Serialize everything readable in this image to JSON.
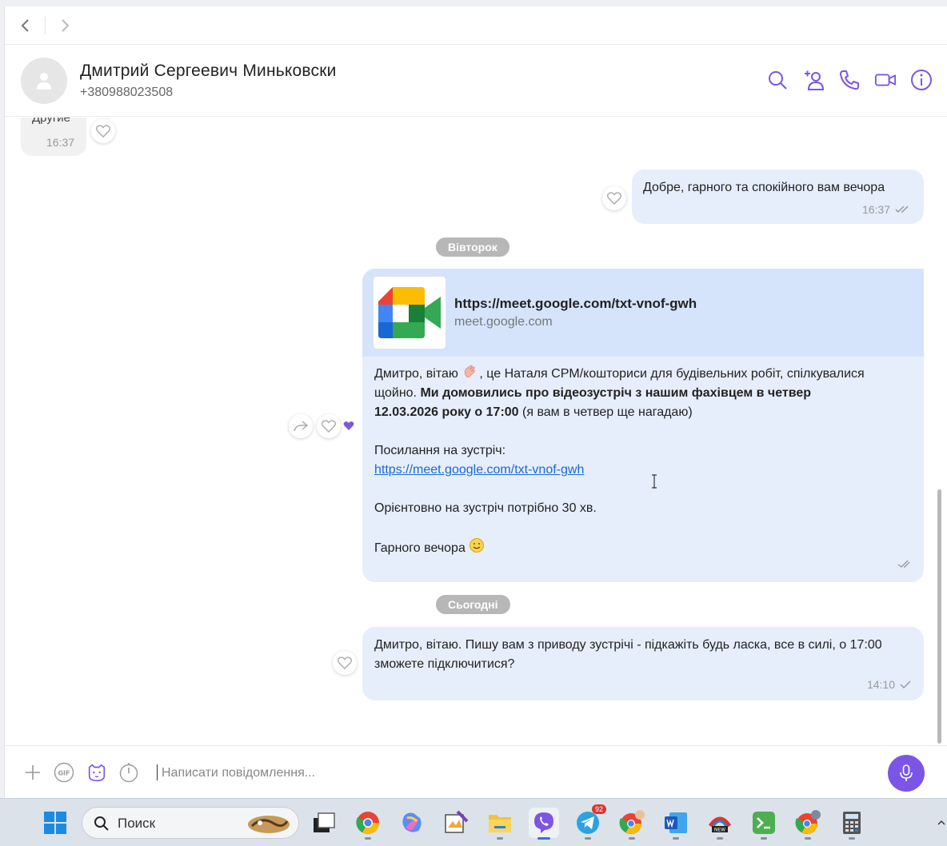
{
  "contact": {
    "name": "Дмитрий Сергеевич Миньковски",
    "phone": "+380988023508"
  },
  "messages": {
    "incoming_preview": {
      "text": "Другие",
      "time": "16:37"
    },
    "out1": {
      "text": "Добре, гарного та спокійного вам вечора",
      "time": "16:37"
    },
    "date1": "Вівторок",
    "out2": {
      "link_title": "https://meet.google.com/txt-vnof-gwh",
      "link_domain": "meet.google.com",
      "p1_a": "Дмитро, вітаю ",
      "p1_b": ", це Наталя CPM/кошториси для будівельних робіт, спілкувалися щойно. ",
      "p1_bold": "Ми домовились про відеозустріч з нашим фахівцем в четвер 12.03.2026 року о 17:00",
      "p1_c": " (я вам в четвер ще нагадаю)",
      "p2_label": "Посилання на зустріч:",
      "p2_link": "https://meet.google.com/txt-vnof-gwh",
      "p3": "Орієнтовно на зустріч потрібно 30 хв.",
      "p4": "Гарного вечора "
    },
    "date2": "Сьогодні",
    "out3": {
      "text": "Дмитро, вітаю. Пишу вам з приводу зустрічі - підкажіть будь ласка, все в силі, о 17:00 зможете підключитися?",
      "time": "14:10"
    }
  },
  "composer": {
    "placeholder": "Написати повідомлення..."
  },
  "taskbar": {
    "search_label": "Поиск",
    "telegram_badge": "92"
  },
  "colors": {
    "accent": "#7c55e6",
    "bubble_out": "#e6eefc",
    "link": "#1a68d6"
  }
}
